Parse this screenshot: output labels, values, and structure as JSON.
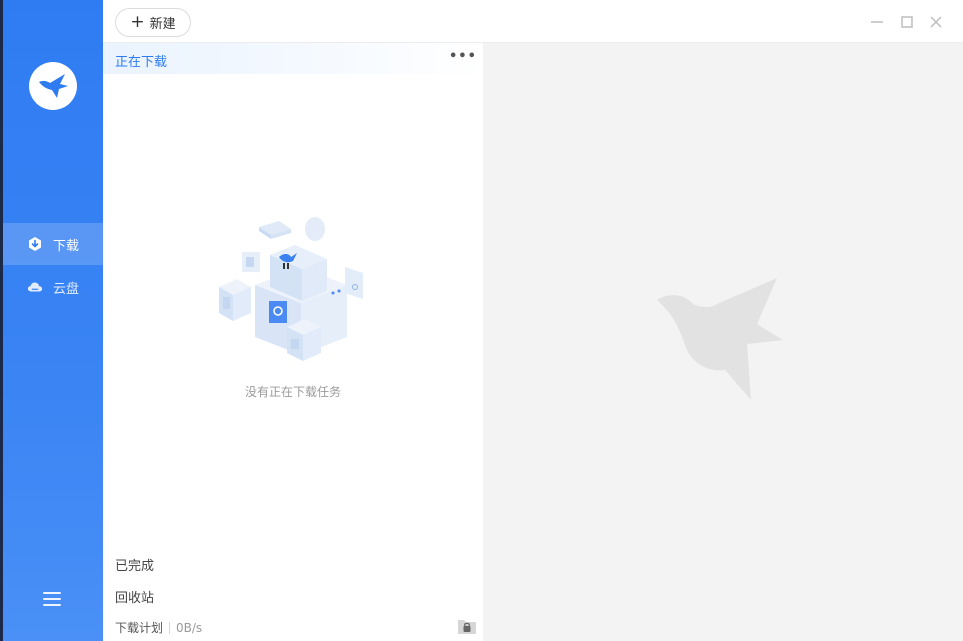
{
  "toolbar": {
    "new_label": "新建"
  },
  "sidebar": {
    "items": [
      {
        "label": "下载",
        "icon": "download-icon",
        "active": true
      },
      {
        "label": "云盘",
        "icon": "cloud-icon",
        "active": false
      }
    ],
    "menu_icon": "hamburger-icon"
  },
  "panel": {
    "title": "正在下载",
    "more": "•••",
    "empty_text": "没有正在下载任务",
    "completed_label": "已完成",
    "trash_label": "回收站",
    "schedule_label": "下载计划",
    "speed": "0B/s"
  },
  "colors": {
    "accent": "#2f7cf2",
    "sidebar": "#3a84f4",
    "right_bg": "#f3f3f3"
  }
}
